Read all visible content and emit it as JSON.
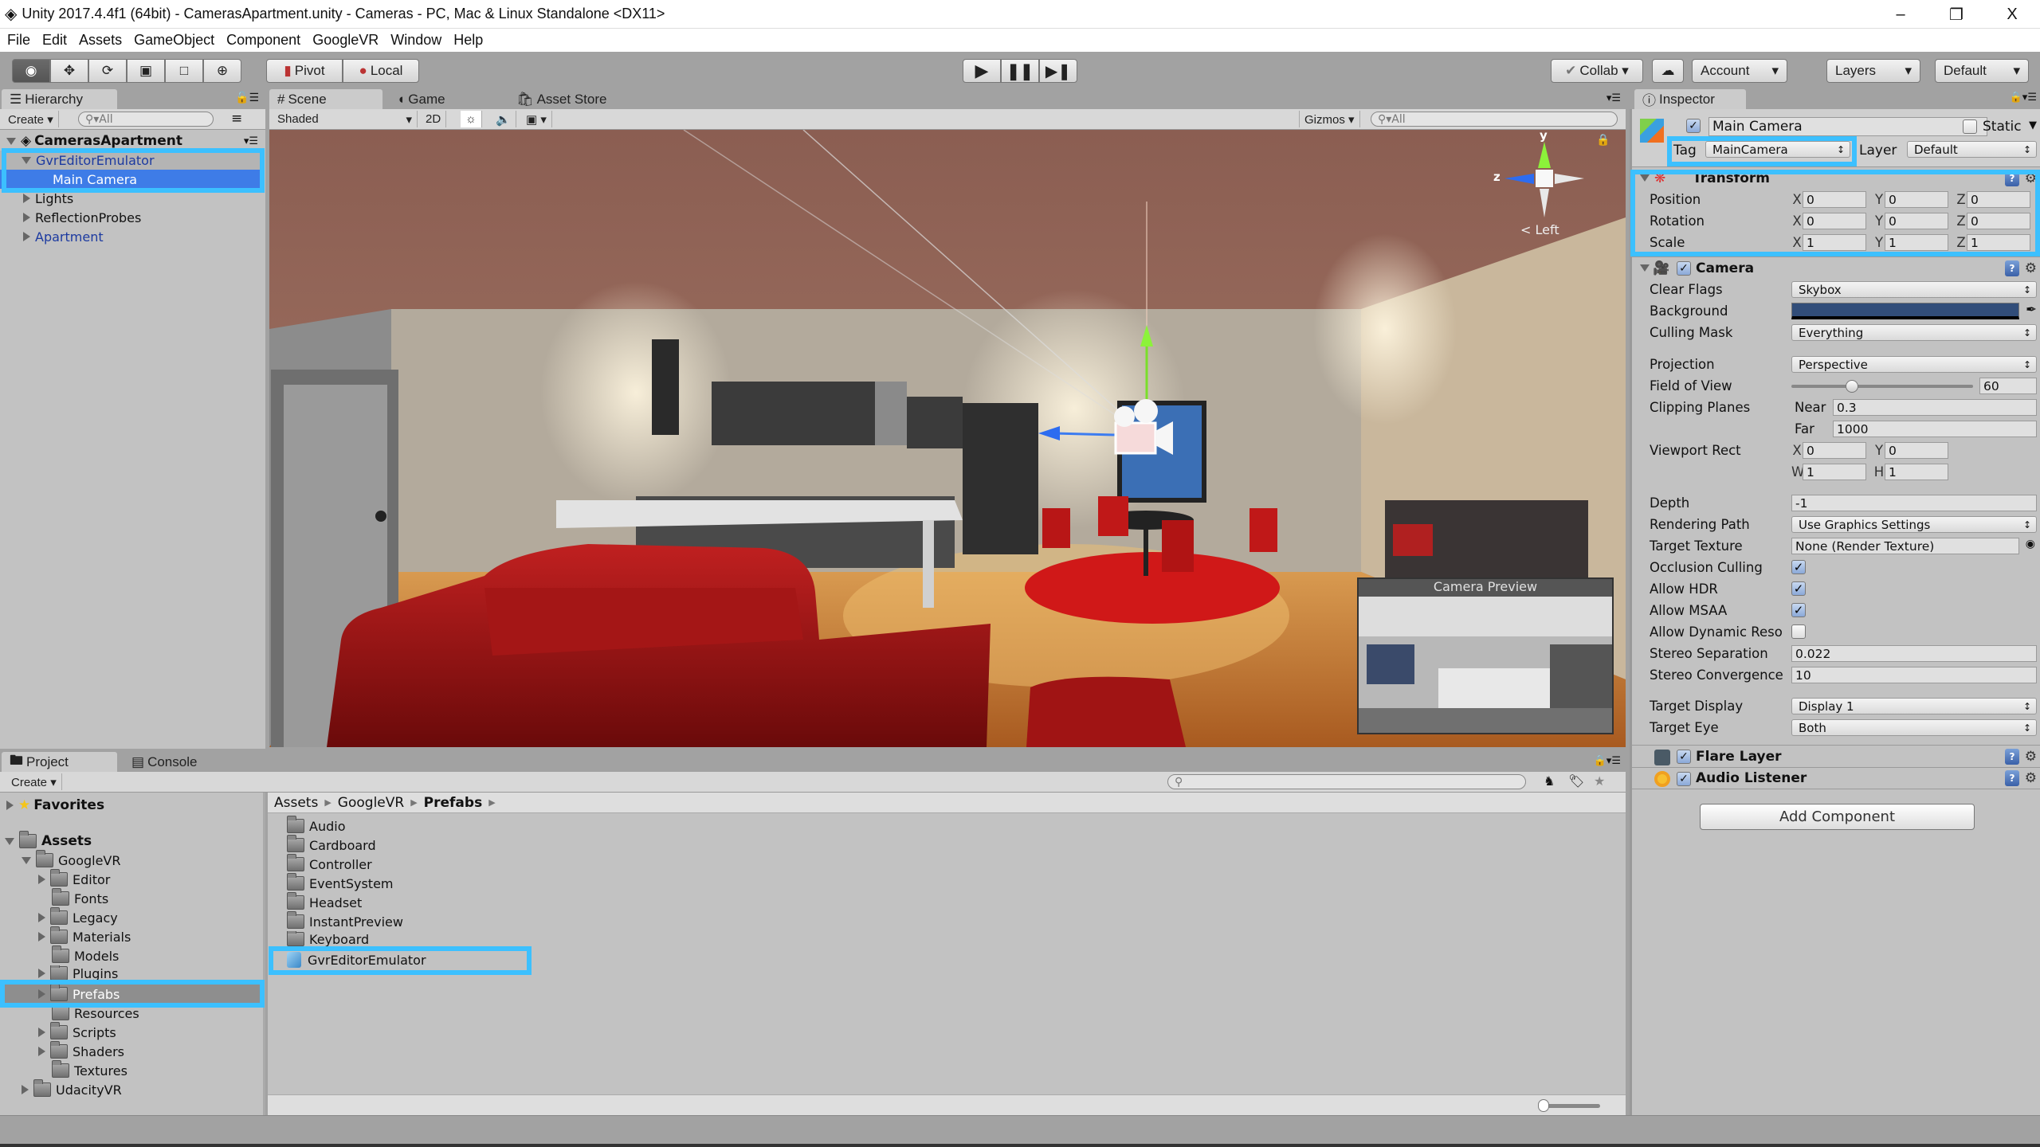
{
  "window": {
    "title": "Unity 2017.4.4f1 (64bit) - CamerasApartment.unity - Cameras - PC, Mac & Linux Standalone <DX11>",
    "minimize": "–",
    "restore": "❐",
    "close": "X"
  },
  "menu": [
    "File",
    "Edit",
    "Assets",
    "GameObject",
    "Component",
    "GoogleVR",
    "Window",
    "Help"
  ],
  "toolbar": {
    "pivot": "Pivot",
    "local": "Local",
    "collab": "Collab ▾",
    "account": "Account",
    "layers": "Layers",
    "layout": "Default",
    "dropdown_arrow": "▾"
  },
  "hierarchy": {
    "tab": "Hierarchy",
    "create": "Create ▾",
    "search_placeholder": "All",
    "scene": "CamerasApartment",
    "items": [
      {
        "label": "GvrEditorEmulator"
      },
      {
        "label": "Main Camera"
      },
      {
        "label": "Lights"
      },
      {
        "label": "ReflectionProbes"
      },
      {
        "label": "Apartment"
      }
    ]
  },
  "scene_view": {
    "tabs": [
      "Scene",
      "Game",
      "Asset Store"
    ],
    "shading": "Shaded",
    "mode_2d": "2D",
    "gizmos": "Gizmos ▾",
    "search_placeholder": "All",
    "gizmo_axes": {
      "y": "y",
      "z": "z"
    },
    "view_label": "< Left",
    "camera_preview": "Camera Preview"
  },
  "inspector": {
    "tab": "Inspector",
    "object_name": "Main Camera",
    "static_label": "Static",
    "tag_label": "Tag",
    "tag_value": "MainCamera",
    "layer_label": "Layer",
    "layer_value": "Default",
    "transform": {
      "title": "Transform",
      "position": {
        "label": "Position",
        "x": "0",
        "y": "0",
        "z": "0"
      },
      "rotation": {
        "label": "Rotation",
        "x": "0",
        "y": "0",
        "z": "0"
      },
      "scale": {
        "label": "Scale",
        "x": "1",
        "y": "1",
        "z": "1"
      }
    },
    "camera": {
      "title": "Camera",
      "clear_flags": {
        "label": "Clear Flags",
        "value": "Skybox"
      },
      "background": {
        "label": "Background",
        "color": "#314d79"
      },
      "culling_mask": {
        "label": "Culling Mask",
        "value": "Everything"
      },
      "projection": {
        "label": "Projection",
        "value": "Perspective"
      },
      "fov": {
        "label": "Field of View",
        "value": "60",
        "min": 1,
        "max": 179
      },
      "clipping": {
        "label": "Clipping Planes",
        "near_label": "Near",
        "near": "0.3",
        "far_label": "Far",
        "far": "1000"
      },
      "viewport": {
        "label": "Viewport Rect",
        "x": "0",
        "y": "0",
        "w": "1",
        "h": "1"
      },
      "depth": {
        "label": "Depth",
        "value": "-1"
      },
      "rendering_path": {
        "label": "Rendering Path",
        "value": "Use Graphics Settings"
      },
      "target_texture": {
        "label": "Target Texture",
        "value": "None (Render Texture)"
      },
      "occlusion": {
        "label": "Occlusion Culling",
        "checked": true
      },
      "hdr": {
        "label": "Allow HDR",
        "checked": true
      },
      "msaa": {
        "label": "Allow MSAA",
        "checked": true
      },
      "dynamic": {
        "label": "Allow Dynamic Reso",
        "checked": false
      },
      "stereo_sep": {
        "label": "Stereo Separation",
        "value": "0.022"
      },
      "stereo_conv": {
        "label": "Stereo Convergence",
        "value": "10"
      },
      "target_display": {
        "label": "Target Display",
        "value": "Display 1"
      },
      "target_eye": {
        "label": "Target Eye",
        "value": "Both"
      }
    },
    "flare_layer": "Flare Layer",
    "audio_listener": "Audio Listener",
    "add_component": "Add Component"
  },
  "project": {
    "tabs": [
      "Project",
      "Console"
    ],
    "create": "Create ▾",
    "favorites": "Favorites",
    "assets": "Assets",
    "tree": [
      {
        "label": "GoogleVR"
      },
      {
        "label": "Editor"
      },
      {
        "label": "Fonts"
      },
      {
        "label": "Legacy"
      },
      {
        "label": "Materials"
      },
      {
        "label": "Models"
      },
      {
        "label": "Plugins"
      },
      {
        "label": "Prefabs"
      },
      {
        "label": "Resources"
      },
      {
        "label": "Scripts"
      },
      {
        "label": "Shaders"
      },
      {
        "label": "Textures"
      },
      {
        "label": "UdacityVR"
      }
    ],
    "breadcrumb": [
      "Assets",
      "GoogleVR",
      "Prefabs"
    ],
    "items": [
      {
        "label": "Audio"
      },
      {
        "label": "Cardboard"
      },
      {
        "label": "Controller"
      },
      {
        "label": "EventSystem"
      },
      {
        "label": "Headset"
      },
      {
        "label": "InstantPreview"
      },
      {
        "label": "Keyboard"
      },
      {
        "label": "GvrEditorEmulator"
      }
    ]
  },
  "colors": {
    "highlight": "#3cc0ff",
    "selection": "#3e7ce7",
    "accent_blue": "#1c3aa0"
  }
}
